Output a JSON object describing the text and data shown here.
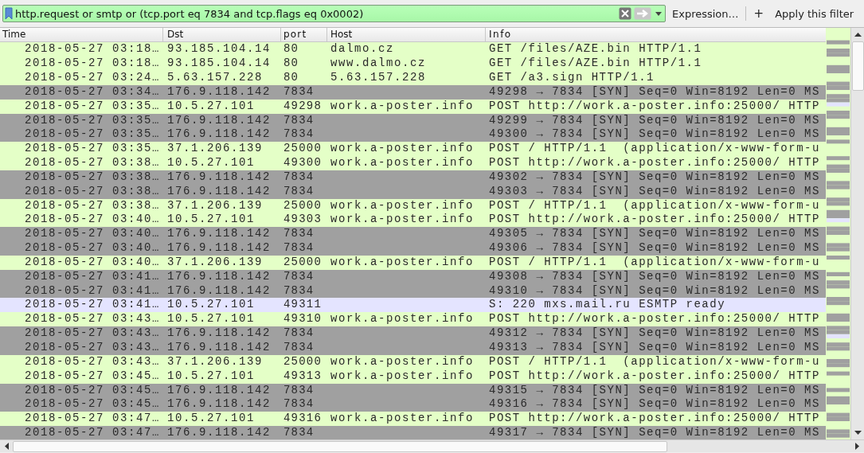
{
  "filter_bar": {
    "value": "http.request or smtp or (tcp.port eq 7834 and tcp.flags eq 0x0002)",
    "expression_button": "Expression…",
    "add_button": "+",
    "apply_button": "Apply this filter"
  },
  "table": {
    "columns": [
      "Time",
      "Dst",
      "port",
      "Host",
      "Info"
    ],
    "rows": [
      {
        "kind": "http",
        "time": "2018-05-27 03:18…",
        "dst": "93.185.104.14",
        "port": "80",
        "host": "dalmo.cz",
        "info": "GET /files/AZE.bin HTTP/1.1"
      },
      {
        "kind": "http",
        "time": "2018-05-27 03:18…",
        "dst": "93.185.104.14",
        "port": "80",
        "host": "www.dalmo.cz",
        "info": "GET /files/AZE.bin HTTP/1.1"
      },
      {
        "kind": "http",
        "time": "2018-05-27 03:24…",
        "dst": "5.63.157.228",
        "port": "80",
        "host": "5.63.157.228",
        "info": "GET /a3.sign HTTP/1.1"
      },
      {
        "kind": "syn",
        "time": "2018-05-27 03:34…",
        "dst": "176.9.118.142",
        "port": "7834",
        "info": "49298 → 7834 [SYN] Seq=0 Win=8192 Len=0 MS"
      },
      {
        "kind": "http",
        "time": "2018-05-27 03:35…",
        "dst": "10.5.27.101",
        "port": "49298",
        "host": "work.a-poster.info",
        "info": "POST http://work.a-poster.info:25000/ HTTP"
      },
      {
        "kind": "syn",
        "time": "2018-05-27 03:35…",
        "dst": "176.9.118.142",
        "port": "7834",
        "info": "49299 → 7834 [SYN] Seq=0 Win=8192 Len=0 MS"
      },
      {
        "kind": "syn",
        "time": "2018-05-27 03:35…",
        "dst": "176.9.118.142",
        "port": "7834",
        "info": "49300 → 7834 [SYN] Seq=0 Win=8192 Len=0 MS"
      },
      {
        "kind": "http",
        "time": "2018-05-27 03:35…",
        "dst": "37.1.206.139",
        "port": "25000",
        "host": "work.a-poster.info",
        "info": "POST / HTTP/1.1  (application/x-www-form-u"
      },
      {
        "kind": "http",
        "time": "2018-05-27 03:38…",
        "dst": "10.5.27.101",
        "port": "49300",
        "host": "work.a-poster.info",
        "info": "POST http://work.a-poster.info:25000/ HTTP"
      },
      {
        "kind": "syn",
        "time": "2018-05-27 03:38…",
        "dst": "176.9.118.142",
        "port": "7834",
        "info": "49302 → 7834 [SYN] Seq=0 Win=8192 Len=0 MS"
      },
      {
        "kind": "syn",
        "time": "2018-05-27 03:38…",
        "dst": "176.9.118.142",
        "port": "7834",
        "info": "49303 → 7834 [SYN] Seq=0 Win=8192 Len=0 MS"
      },
      {
        "kind": "http",
        "time": "2018-05-27 03:38…",
        "dst": "37.1.206.139",
        "port": "25000",
        "host": "work.a-poster.info",
        "info": "POST / HTTP/1.1  (application/x-www-form-u"
      },
      {
        "kind": "http",
        "time": "2018-05-27 03:40…",
        "dst": "10.5.27.101",
        "port": "49303",
        "host": "work.a-poster.info",
        "info": "POST http://work.a-poster.info:25000/ HTTP"
      },
      {
        "kind": "syn",
        "time": "2018-05-27 03:40…",
        "dst": "176.9.118.142",
        "port": "7834",
        "info": "49305 → 7834 [SYN] Seq=0 Win=8192 Len=0 MS"
      },
      {
        "kind": "syn",
        "time": "2018-05-27 03:40…",
        "dst": "176.9.118.142",
        "port": "7834",
        "info": "49306 → 7834 [SYN] Seq=0 Win=8192 Len=0 MS"
      },
      {
        "kind": "http",
        "time": "2018-05-27 03:40…",
        "dst": "37.1.206.139",
        "port": "25000",
        "host": "work.a-poster.info",
        "info": "POST / HTTP/1.1  (application/x-www-form-u"
      },
      {
        "kind": "syn",
        "time": "2018-05-27 03:41…",
        "dst": "176.9.118.142",
        "port": "7834",
        "info": "49308 → 7834 [SYN] Seq=0 Win=8192 Len=0 MS"
      },
      {
        "kind": "syn",
        "time": "2018-05-27 03:41…",
        "dst": "176.9.118.142",
        "port": "7834",
        "info": "49310 → 7834 [SYN] Seq=0 Win=8192 Len=0 MS"
      },
      {
        "kind": "smtp",
        "time": "2018-05-27 03:41…",
        "dst": "10.5.27.101",
        "port": "49311",
        "info": "S: 220 mxs.mail.ru ESMTP ready"
      },
      {
        "kind": "http",
        "time": "2018-05-27 03:43…",
        "dst": "10.5.27.101",
        "port": "49310",
        "host": "work.a-poster.info",
        "info": "POST http://work.a-poster.info:25000/ HTTP"
      },
      {
        "kind": "syn",
        "time": "2018-05-27 03:43…",
        "dst": "176.9.118.142",
        "port": "7834",
        "info": "49312 → 7834 [SYN] Seq=0 Win=8192 Len=0 MS"
      },
      {
        "kind": "syn",
        "time": "2018-05-27 03:43…",
        "dst": "176.9.118.142",
        "port": "7834",
        "info": "49313 → 7834 [SYN] Seq=0 Win=8192 Len=0 MS"
      },
      {
        "kind": "http",
        "time": "2018-05-27 03:43…",
        "dst": "37.1.206.139",
        "port": "25000",
        "host": "work.a-poster.info",
        "info": "POST / HTTP/1.1  (application/x-www-form-u"
      },
      {
        "kind": "http",
        "time": "2018-05-27 03:45…",
        "dst": "10.5.27.101",
        "port": "49313",
        "host": "work.a-poster.info",
        "info": "POST http://work.a-poster.info:25000/ HTTP"
      },
      {
        "kind": "syn",
        "time": "2018-05-27 03:45…",
        "dst": "176.9.118.142",
        "port": "7834",
        "info": "49315 → 7834 [SYN] Seq=0 Win=8192 Len=0 MS"
      },
      {
        "kind": "syn",
        "time": "2018-05-27 03:45…",
        "dst": "176.9.118.142",
        "port": "7834",
        "info": "49316 → 7834 [SYN] Seq=0 Win=8192 Len=0 MS"
      },
      {
        "kind": "http",
        "time": "2018-05-27 03:47…",
        "dst": "10.5.27.101",
        "port": "49316",
        "host": "work.a-poster.info",
        "info": "POST http://work.a-poster.info:25000/ HTTP"
      },
      {
        "kind": "syn",
        "time": "2018-05-27 03:47…",
        "dst": "176.9.118.142",
        "port": "7834",
        "info": "49317 → 7834 [SYN] Seq=0 Win=8192 Len=0 MS"
      }
    ]
  }
}
